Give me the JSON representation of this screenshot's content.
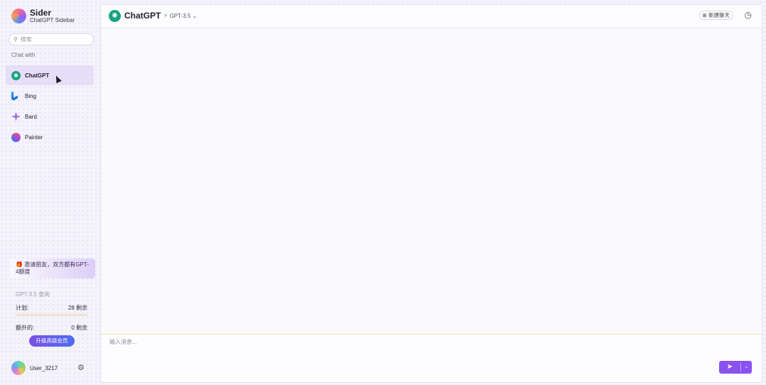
{
  "brand": {
    "name": "Sider",
    "subtitle": "ChatGPT Sidebar"
  },
  "search": {
    "placeholder": "搜索",
    "icon": "search-icon"
  },
  "sidebar": {
    "chat_with_label": "Chat with",
    "items": [
      {
        "label": "ChatGPT",
        "icon": "chatgpt-icon",
        "active": true
      },
      {
        "label": "Bing",
        "icon": "bing-icon",
        "active": false
      },
      {
        "label": "Bard",
        "icon": "bard-icon",
        "active": false
      },
      {
        "label": "Painter",
        "icon": "painter-icon",
        "active": false
      }
    ],
    "invite_text": "邀请朋友，双方都有GPT-4额度",
    "quota": {
      "title": "GPT-3.5 查询",
      "rows": [
        {
          "label": "计划:",
          "value": "28 剩余"
        },
        {
          "label": "额外的:",
          "value": "0 剩余"
        }
      ]
    },
    "upgrade_label": "升级高级会员",
    "user_name": "User_3217"
  },
  "topbar": {
    "title": "ChatGPT",
    "model": "GPT-3.5",
    "new_chat_label": "新建聊天"
  },
  "composer": {
    "placeholder": "输入消息..."
  },
  "colors": {
    "accent": "#8a52f0",
    "chatgpt_green": "#19a37f",
    "upgrade_gradient_start": "#7b4fe6"
  }
}
